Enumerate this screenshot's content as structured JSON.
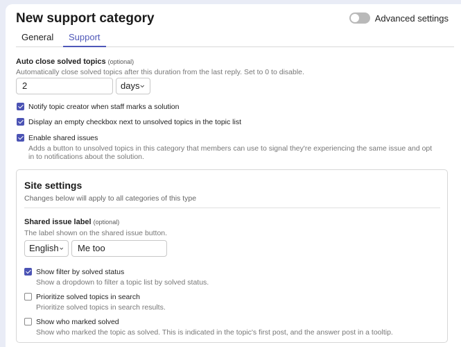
{
  "header": {
    "title": "New support category",
    "advanced_label": "Advanced settings"
  },
  "tabs": [
    {
      "label": "General",
      "active": false
    },
    {
      "label": "Support",
      "active": true
    }
  ],
  "auto_close": {
    "label": "Auto close solved topics",
    "optional": "(optional)",
    "description": "Automatically close solved topics after this duration from the last reply. Set to 0 to disable.",
    "value": "2",
    "unit": "days"
  },
  "checkboxes": [
    {
      "label": "Notify topic creator when staff marks a solution",
      "checked": true
    },
    {
      "label": "Display an empty checkbox next to unsolved topics in the topic list",
      "checked": true
    },
    {
      "label": "Enable shared issues",
      "checked": true,
      "description": "Adds a button to unsolved topics in this category that members can use to signal they're experiencing the same issue and opt in to notifications about the solution."
    }
  ],
  "site_settings": {
    "title": "Site settings",
    "subtitle": "Changes below will apply to all categories of this type",
    "shared_label": {
      "label": "Shared issue label",
      "optional": "(optional)",
      "description": "The label shown on the shared issue button.",
      "language": "English",
      "value": "Me too"
    },
    "options": [
      {
        "label": "Show filter by solved status",
        "checked": true,
        "description": "Show a dropdown to filter a topic list by solved status."
      },
      {
        "label": "Prioritize solved topics in search",
        "checked": false,
        "description": "Prioritize solved topics in search results."
      },
      {
        "label": "Show who marked solved",
        "checked": false,
        "description": "Show who marked the topic as solved. This is indicated in the topic's first post, and the answer post in a tooltip."
      }
    ]
  },
  "colors": {
    "accent": "#4e57b8",
    "checkbox": "#4b53b4",
    "background": "#e9ecf6"
  }
}
